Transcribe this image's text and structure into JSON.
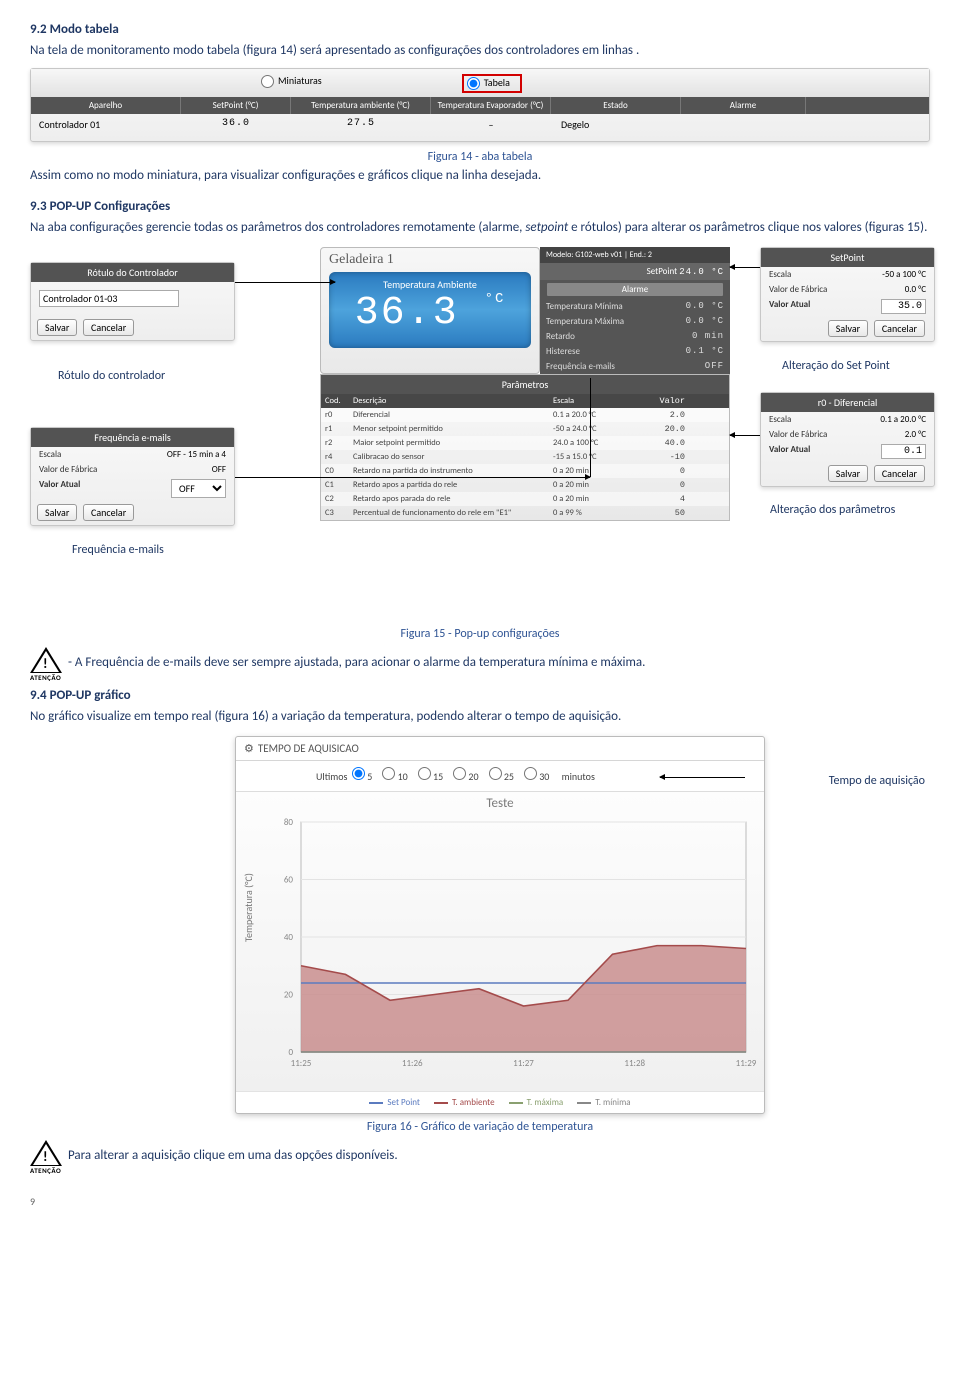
{
  "sec92": {
    "title": "9.2 Modo tabela",
    "p": "Na tela de monitoramento modo tabela (figura 14) será apresentado as configurações dos  controladores em linhas ."
  },
  "fig14": {
    "tabs": {
      "miniaturas": "Miniaturas",
      "tabela": "Tabela"
    },
    "headers": [
      "Aparelho",
      "SetPoint (°C)",
      "Temperatura ambiente (°C)",
      "Temperatura Evaporador (°C)",
      "Estado",
      "Alarme"
    ],
    "row": {
      "aparelho": "Controlador 01",
      "sp": "36.0",
      "tamb": "27.5",
      "tevap": "–",
      "estado": "Degelo",
      "alarme": ""
    },
    "caption": "Figura 14 - aba tabela"
  },
  "p_after14": "Assim como no modo miniatura, para visualizar configurações e gráficos clique na linha desejada.",
  "sec93": {
    "title": "9.3 POP-UP Configurações",
    "p": "Na aba configurações gerencie todas os parâmetros dos controladores remotamente (alarme, setpoint e rótulos) para alterar os parâmetros clique nos valores (figuras 15)."
  },
  "rotulo": {
    "hdr": "Rótulo do Controlador",
    "value": "Controlador 01-03",
    "salvar": "Salvar",
    "cancelar": "Cancelar",
    "caption": "Rótulo do controlador"
  },
  "freq": {
    "hdr": "Frequência e-mails",
    "escala_k": "Escala",
    "escala_v": "OFF - 15 min a 4",
    "fab_k": "Valor de Fábrica",
    "fab_v": "OFF",
    "atual_k": "Valor Atual",
    "atual_v": "OFF",
    "caption": "Frequência e-mails"
  },
  "device": {
    "name": "Geladeira 1",
    "lcd_label": "Temperatura Ambiente",
    "lcd_val": "36.3",
    "lcd_unit": "°C",
    "model": "Modelo: G102-web v01 | End.: 2",
    "sp_k": "SetPoint",
    "sp_v": "24.0 °C",
    "alarm": "Alarme",
    "rows": [
      {
        "k": "Temperatura Mínima",
        "v": "0.0 °C"
      },
      {
        "k": "Temperatura Máxima",
        "v": "0.0 °C"
      },
      {
        "k": "Retardo",
        "v": "0 min"
      },
      {
        "k": "Histerese",
        "v": "0.1 °C"
      },
      {
        "k": "Frequência e-mails",
        "v": "OFF"
      }
    ]
  },
  "params": {
    "title": "Parâmetros",
    "hdr": [
      "Cod.",
      "Descrição",
      "Escala",
      "Valor"
    ],
    "rows": [
      [
        "r0",
        "Diferencial",
        "0.1 a 20.0 °C",
        "2.0"
      ],
      [
        "r1",
        "Menor setpoint permitido",
        "-50 a 24.0 °C",
        "20.0"
      ],
      [
        "r2",
        "Maior setpoint permitido",
        "24.0 a 100 °C",
        "40.0"
      ],
      [
        "r4",
        "Calibracao do sensor",
        "-15 a 15.0 °C",
        "-10"
      ],
      [
        "C0",
        "Retardo na partida do instrumento",
        "0 a 20 min",
        "0"
      ],
      [
        "C1",
        "Retardo apos a partida do rele",
        "0 a 20 min",
        "0"
      ],
      [
        "C2",
        "Retardo apos parada do rele",
        "0 a 20 min",
        "4"
      ],
      [
        "C3",
        "Percentual de funcionamento do rele em \"E1\"",
        "0 a 99 %",
        "50"
      ]
    ]
  },
  "setpoint": {
    "hdr": "SetPoint",
    "escala_k": "Escala",
    "escala_v": "-50 a 100 °C",
    "fab_k": "Valor de Fábrica",
    "fab_v": "0.0 °C",
    "atual_k": "Valor Atual",
    "atual_v": "35.0",
    "caption": "Alteração do Set Point"
  },
  "r0box": {
    "hdr": "r0 - Diferencial",
    "escala_k": "Escala",
    "escala_v": "0.1 a 20.0 °C",
    "fab_k": "Valor de Fábrica",
    "fab_v": "2.0 °C",
    "atual_k": "Valor Atual",
    "atual_v": "0.1",
    "caption": "Alteração dos parâmetros"
  },
  "buttons": {
    "salvar": "Salvar",
    "cancelar": "Cancelar"
  },
  "fig15_caption": "Figura 15 - Pop-up configurações",
  "att1": {
    "label": "ATENÇÃO",
    "text": "- A Frequência de e-mails deve ser sempre ajustada, para acionar o alarme da temperatura mínima e máxima."
  },
  "sec94": {
    "title": "9.4 POP-UP gráfico",
    "p": "No gráfico visualize em tempo real (figura 16) a variação da temperatura, podendo alterar o tempo de aquisição."
  },
  "fig16": {
    "hdr": "TEMPO DE AQUISICAO",
    "ultimos": "Ultimos",
    "opts": [
      "5",
      "10",
      "15",
      "20",
      "25",
      "30"
    ],
    "unit": "minutos",
    "tempo_lbl": "Tempo de aquisição",
    "plot_title": "Teste",
    "ylabel": "Temperatura (°C)",
    "legend": [
      "Set Point",
      "T. ambiente",
      "T. máxima",
      "T. mínima"
    ],
    "caption": "Figura 16 - Gráfico de variação de temperatura"
  },
  "att2": {
    "label": "ATENÇÃO",
    "text": "Para alterar a aquisição clique em uma das opções disponíveis."
  },
  "pagenum": "9",
  "chart_data": {
    "type": "line",
    "title": "Teste",
    "xlabel": "",
    "ylabel": "Temperatura (°C)",
    "ylim": [
      0,
      80
    ],
    "x_ticks": [
      "11:25",
      "11:26",
      "11:27",
      "11:28",
      "11:29"
    ],
    "series": [
      {
        "name": "Set Point",
        "color": "#5b7bbf",
        "values": [
          24,
          24,
          24,
          24,
          24,
          24,
          24,
          24,
          24,
          24,
          24
        ]
      },
      {
        "name": "T. ambiente",
        "color": "#a44b4b",
        "values": [
          30,
          27,
          18,
          20,
          22,
          16,
          18,
          34,
          37,
          37,
          36
        ]
      },
      {
        "name": "T. máxima",
        "color": "#8aa070",
        "values": [
          0,
          0,
          0,
          0,
          0,
          0,
          0,
          0,
          0,
          0,
          0
        ]
      },
      {
        "name": "T. mínima",
        "color": "#888888",
        "values": [
          0,
          0,
          0,
          0,
          0,
          0,
          0,
          0,
          0,
          0,
          0
        ]
      }
    ]
  }
}
